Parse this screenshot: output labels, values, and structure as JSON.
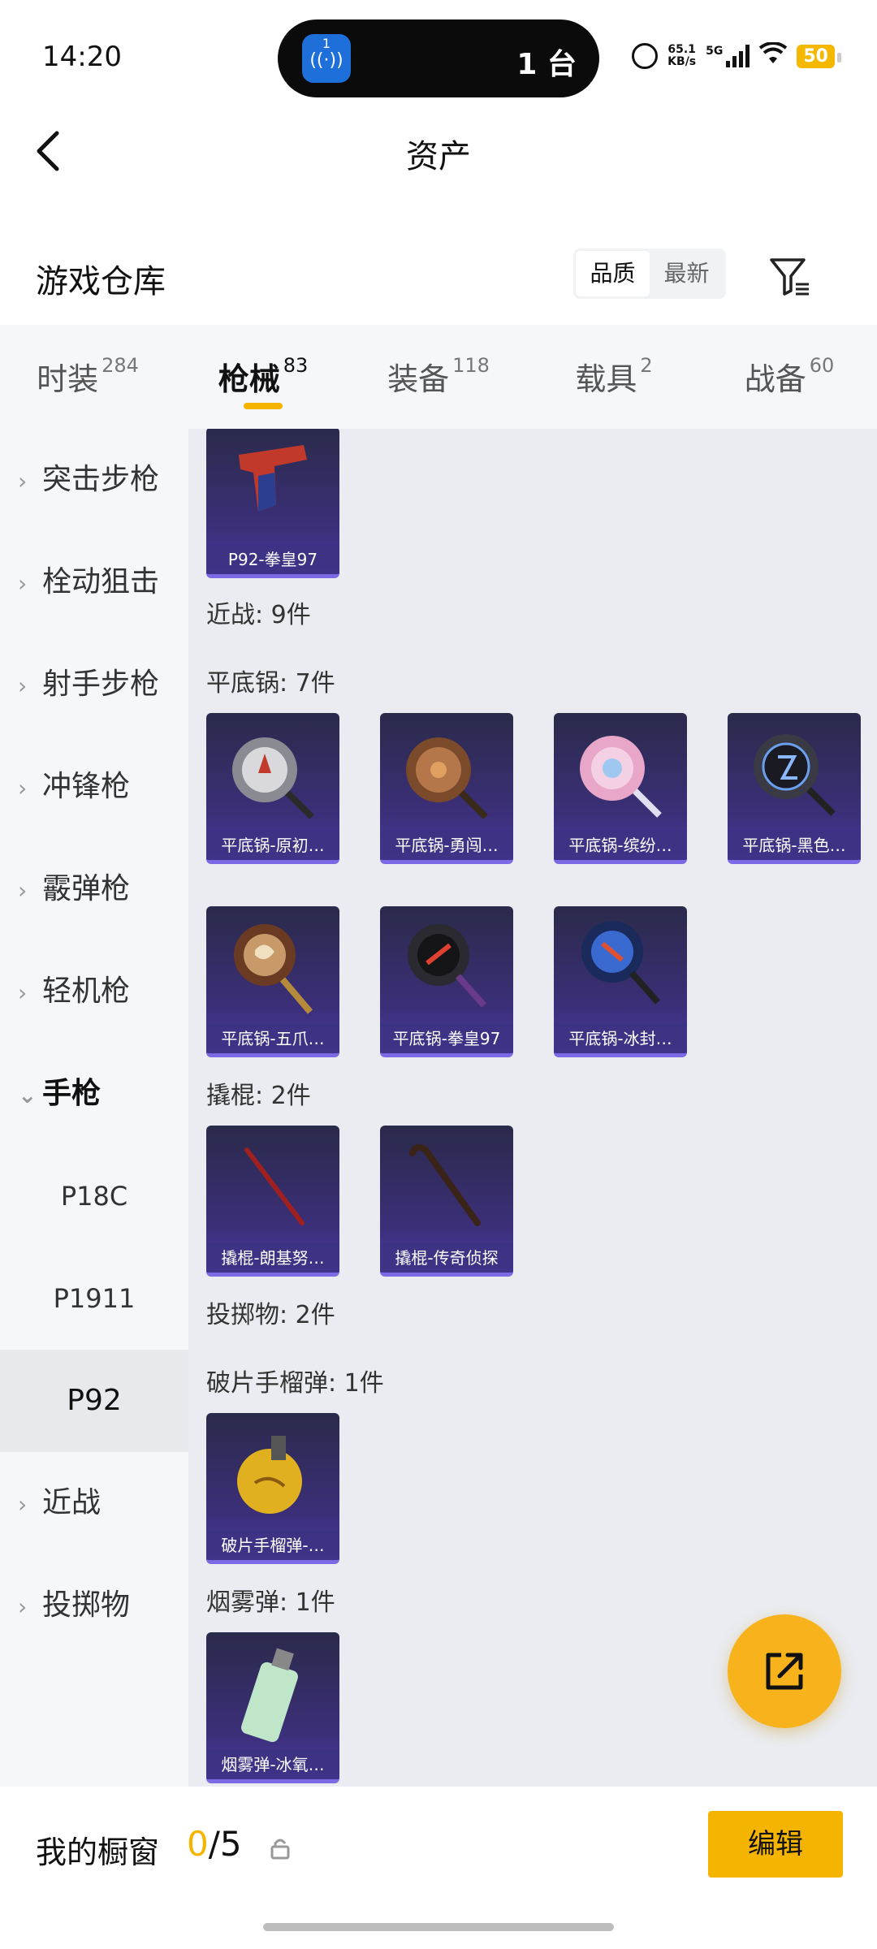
{
  "status": {
    "time": "14:20",
    "island_badge": "1",
    "island_text": "1 台",
    "net_speed_value": "65.1",
    "net_speed_unit": "KB/s",
    "network": "5G",
    "battery": "50"
  },
  "header": {
    "title": "资产"
  },
  "warehouse": {
    "title": "游戏仓库",
    "sort_options": [
      "品质",
      "最新"
    ],
    "sort_selected": "品质"
  },
  "tabs": [
    {
      "label": "时装",
      "count": "284"
    },
    {
      "label": "枪械",
      "count": "83",
      "active": true
    },
    {
      "label": "装备",
      "count": "118"
    },
    {
      "label": "载具",
      "count": "2"
    },
    {
      "label": "战备",
      "count": "60"
    }
  ],
  "sidebar": {
    "items": [
      {
        "label": "突击步枪"
      },
      {
        "label": "栓动狙击"
      },
      {
        "label": "射手步枪"
      },
      {
        "label": "冲锋枪"
      },
      {
        "label": "霰弹枪"
      },
      {
        "label": "轻机枪"
      },
      {
        "label": "手枪"
      },
      {
        "label": "近战"
      },
      {
        "label": "投掷物"
      }
    ],
    "subitems": [
      {
        "label": "P18C"
      },
      {
        "label": "P1911"
      },
      {
        "label": "P92"
      }
    ]
  },
  "content": {
    "groups": {
      "melee": "近战: 9件",
      "pan": "平底锅: 7件",
      "crowbar": "撬棍: 2件",
      "throwable": "投掷物: 2件",
      "frag": "破片手榴弹: 1件",
      "smoke": "烟雾弹: 1件"
    },
    "cards": {
      "p92": "P92-拳皇97",
      "pan1": "平底锅-原初…",
      "pan2": "平底锅-勇闯…",
      "pan3": "平底锅-缤纷…",
      "pan4": "平底锅-黑色…",
      "pan5": "平底锅-五爪…",
      "pan6": "平底锅-拳皇97",
      "pan7": "平底锅-冰封…",
      "crowbar1": "撬棍-朗基努…",
      "crowbar2": "撬棍-传奇侦探",
      "frag1": "破片手榴弹-…",
      "smoke1": "烟雾弹-冰氧…"
    }
  },
  "bottom": {
    "showcase_label": "我的橱窗",
    "showcase_current": "0",
    "showcase_total": "/5",
    "edit_label": "编辑"
  },
  "colors": {
    "accent": "#f5b400",
    "card_bg": "#3c2f7a",
    "content_bg": "#eaecf1"
  }
}
